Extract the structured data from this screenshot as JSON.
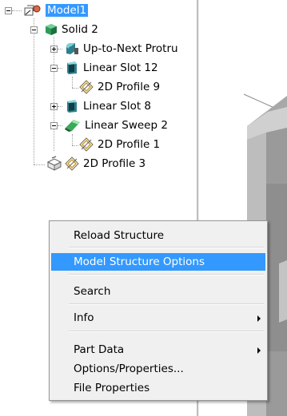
{
  "tree": {
    "nodes": {
      "model": "Model1",
      "solid": "Solid 2",
      "protrusion": "Up-to-Next Protru",
      "slot12": "Linear Slot 12",
      "profile9": "2D Profile 9",
      "slot8": "Linear Slot 8",
      "sweep": "Linear Sweep 2",
      "profile1": "2D Profile 1",
      "profile3": "2D Profile 3"
    },
    "selected": "Model1"
  },
  "context_menu": {
    "items": [
      {
        "label": "Reload Structure",
        "highlighted": false,
        "submenu": false
      },
      {
        "label": "Model Structure Options",
        "highlighted": true,
        "submenu": false
      },
      {
        "label": "Search",
        "highlighted": false,
        "submenu": false
      },
      {
        "label": "Info",
        "highlighted": false,
        "submenu": true
      },
      {
        "label": "Part Data",
        "highlighted": false,
        "submenu": true
      },
      {
        "label": "Options/Properties...",
        "highlighted": false,
        "submenu": false
      },
      {
        "label": "File Properties",
        "highlighted": false,
        "submenu": false
      }
    ]
  },
  "icons": {
    "model": "model-assembly-icon",
    "solid": "solid-cube-icon",
    "protrusion": "protrusion-feature-icon",
    "slot": "slot-feature-icon",
    "sweep": "sweep-feature-icon",
    "profile": "profile-sketch-icon"
  },
  "colors": {
    "highlight": "#3399ff",
    "menu_background": "#f0f0f0",
    "viewport_background": "#ffffff",
    "model_gray": "#b8b8b8"
  }
}
